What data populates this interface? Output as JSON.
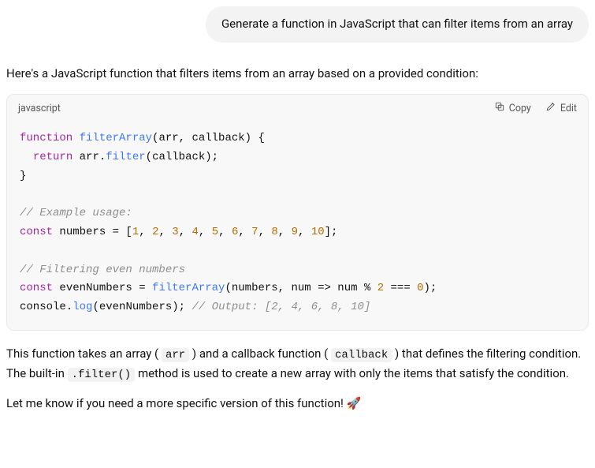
{
  "user_message": "Generate a function in JavaScript that can filter items from an array",
  "assistant": {
    "intro": "Here's a JavaScript function that filters items from an array based on a provided condition:",
    "explain_1a": "This function takes an array (",
    "explain_1b": ") and a callback function (",
    "explain_1c": ") that defines the filtering condition. The built-in ",
    "explain_1d": " method is used to create a new array with only the items that satisfy the condition.",
    "inline_arr": "arr",
    "inline_callback": "callback",
    "inline_filter": ".filter()",
    "closing": "Let me know if you need a more specific version of this function! 🚀"
  },
  "code_block": {
    "language": "javascript",
    "copy_label": "Copy",
    "edit_label": "Edit",
    "tokens": [
      {
        "t": "function",
        "c": "tok-kw"
      },
      {
        "t": " "
      },
      {
        "t": "filterArray",
        "c": "tok-fn"
      },
      {
        "t": "(arr, callback) {"
      },
      {
        "t": "\n"
      },
      {
        "t": "  "
      },
      {
        "t": "return",
        "c": "tok-kw"
      },
      {
        "t": " arr."
      },
      {
        "t": "filter",
        "c": "tok-fn"
      },
      {
        "t": "(callback);"
      },
      {
        "t": "\n"
      },
      {
        "t": "}"
      },
      {
        "t": "\n"
      },
      {
        "t": "\n"
      },
      {
        "t": "// Example usage:",
        "c": "tok-cmt"
      },
      {
        "t": "\n"
      },
      {
        "t": "const",
        "c": "tok-kw"
      },
      {
        "t": " numbers = ["
      },
      {
        "t": "1",
        "c": "tok-num"
      },
      {
        "t": ", "
      },
      {
        "t": "2",
        "c": "tok-num"
      },
      {
        "t": ", "
      },
      {
        "t": "3",
        "c": "tok-num"
      },
      {
        "t": ", "
      },
      {
        "t": "4",
        "c": "tok-num"
      },
      {
        "t": ", "
      },
      {
        "t": "5",
        "c": "tok-num"
      },
      {
        "t": ", "
      },
      {
        "t": "6",
        "c": "tok-num"
      },
      {
        "t": ", "
      },
      {
        "t": "7",
        "c": "tok-num"
      },
      {
        "t": ", "
      },
      {
        "t": "8",
        "c": "tok-num"
      },
      {
        "t": ", "
      },
      {
        "t": "9",
        "c": "tok-num"
      },
      {
        "t": ", "
      },
      {
        "t": "10",
        "c": "tok-num"
      },
      {
        "t": "];"
      },
      {
        "t": "\n"
      },
      {
        "t": "\n"
      },
      {
        "t": "// Filtering even numbers",
        "c": "tok-cmt"
      },
      {
        "t": "\n"
      },
      {
        "t": "const",
        "c": "tok-kw"
      },
      {
        "t": " evenNumbers = "
      },
      {
        "t": "filterArray",
        "c": "tok-fn"
      },
      {
        "t": "(numbers, num => num % "
      },
      {
        "t": "2",
        "c": "tok-num"
      },
      {
        "t": " === "
      },
      {
        "t": "0",
        "c": "tok-num"
      },
      {
        "t": ");"
      },
      {
        "t": "\n"
      },
      {
        "t": "console."
      },
      {
        "t": "log",
        "c": "tok-fn"
      },
      {
        "t": "(evenNumbers); "
      },
      {
        "t": "// Output: [2, 4, 6, 8, 10]",
        "c": "tok-cmt"
      }
    ]
  }
}
